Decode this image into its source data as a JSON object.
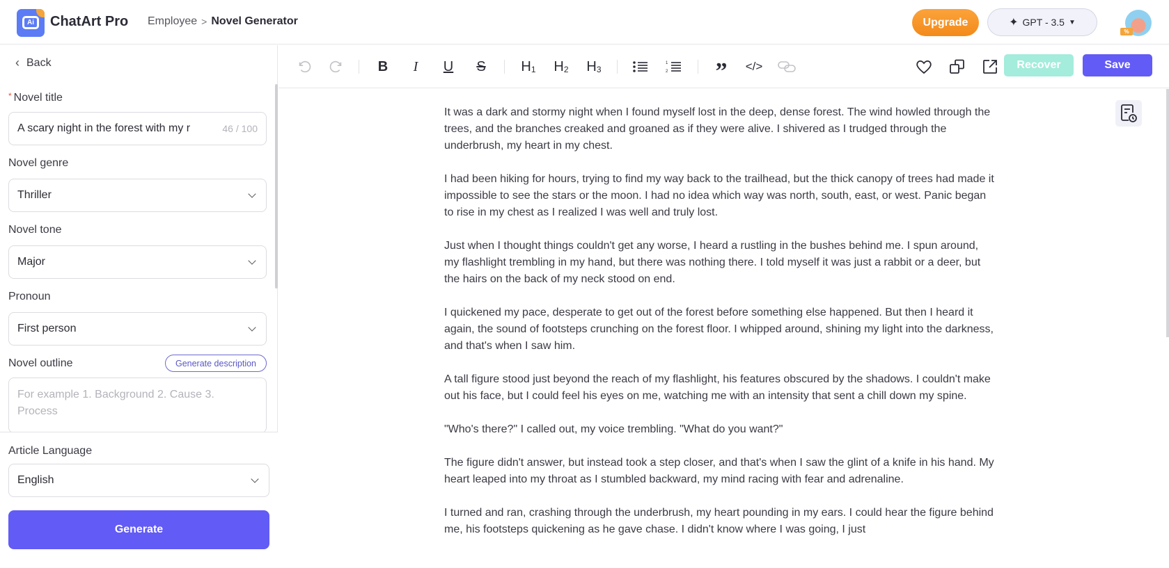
{
  "header": {
    "brand": "ChatArt Pro",
    "breadcrumb": {
      "parent": "Employee",
      "separator": ">",
      "current": "Novel Generator"
    },
    "upgrade_label": "Upgrade",
    "model_selector": {
      "label": "GPT - 3.5",
      "icon": "sparkle-icon"
    },
    "avatar_badge": "%"
  },
  "sidebar": {
    "back_label": "Back",
    "fields": {
      "title": {
        "label": "Novel title",
        "required": "*",
        "value": "A scary night in the forest with my r",
        "counter": "46 / 100"
      },
      "genre": {
        "label": "Novel genre",
        "value": "Thriller"
      },
      "tone": {
        "label": "Novel tone",
        "value": "Major"
      },
      "pronoun": {
        "label": "Pronoun",
        "value": "First person"
      },
      "outline": {
        "label": "Novel outline",
        "action_label": "Generate description",
        "placeholder": "For example 1. Background 2. Cause 3. Process"
      },
      "language": {
        "label": "Article Language",
        "value": "English"
      }
    },
    "generate_label": "Generate"
  },
  "toolbar": {
    "undo": "undo-icon",
    "redo": "redo-icon",
    "bold": "B",
    "italic": "I",
    "underline": "U",
    "strike": "S",
    "h1": "H",
    "h1_sub": "1",
    "h2": "H",
    "h2_sub": "2",
    "h3": "H",
    "h3_sub": "3",
    "quote": "”",
    "code": "</>",
    "recover_label": "Recover",
    "save_label": "Save"
  },
  "document": {
    "paragraphs": [
      "It was a dark and stormy night when I found myself lost in the deep, dense forest. The wind howled through the trees, and the branches creaked and groaned as if they were alive. I shivered as I trudged through the underbrush, my heart in my chest.",
      "I had been hiking for hours, trying to find my way back to the trailhead, but the thick canopy of trees had made it impossible to see the stars or the moon. I had no idea which way was north, south, east, or west. Panic began to rise in my chest as I realized I was well and truly lost.",
      "Just when I thought things couldn't get any worse, I heard a rustling in the bushes behind me. I spun around, my flashlight trembling in my hand, but there was nothing there. I told myself it was just a rabbit or a deer, but the hairs on the back of my neck stood on end.",
      "I quickened my pace, desperate to get out of the forest before something else happened. But then I heard it again, the sound of footsteps crunching on the forest floor. I whipped around, shining my light into the darkness, and that's when I saw him.",
      "A tall figure stood just beyond the reach of my flashlight, his features obscured by the shadows. I couldn't make out his face, but I could feel his eyes on me, watching me with an intensity that sent a chill down my spine.",
      "\"Who's there?\" I called out, my voice trembling. \"What do you want?\"",
      "The figure didn't answer, but instead took a step closer, and that's when I saw the glint of a knife in his hand. My heart leaped into my throat as I stumbled backward, my mind racing with fear and adrenaline.",
      "I turned and ran, crashing through the underbrush, my heart pounding in my ears. I could hear the figure behind me, his footsteps quickening as he gave chase. I didn't know where I was going, I just"
    ]
  },
  "colors": {
    "primary": "#625bf6",
    "upgrade": "#f38a1a",
    "recover_disabled": "#a4ecdc",
    "required": "#e5533d"
  }
}
